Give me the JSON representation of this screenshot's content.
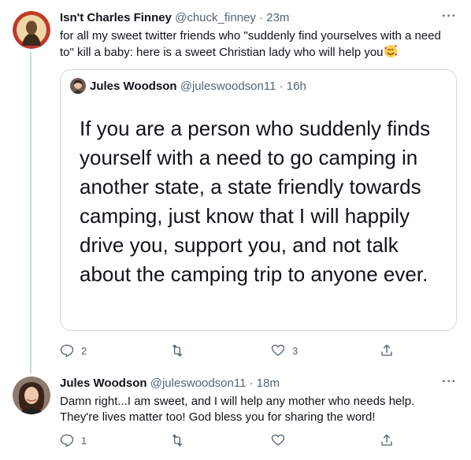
{
  "tweet1": {
    "display_name": "Isn't Charles Finney",
    "handle": "@chuck_finney",
    "separator": "·",
    "time": "23m",
    "text": "for all my sweet twitter friends who \"suddenly find yourselves with a need to\" kill a baby: here is a sweet Christian lady who will help you",
    "emoji": "smiling-face-with-hearts",
    "more_label": "···",
    "quote": {
      "display_name": "Jules Woodson",
      "handle": "@juleswoodson11",
      "separator": "·",
      "time": "16h",
      "text": "If you are a person who suddenly finds yourself with a need to go camping in another state, a state friendly towards camping, just know that I will happily drive you, support you, and not talk about the camping trip to anyone ever."
    },
    "actions": {
      "reply_count": "2",
      "retweet_count": "",
      "like_count": "3"
    }
  },
  "tweet2": {
    "display_name": "Jules Woodson",
    "handle": "@juleswoodson11",
    "separator": "·",
    "time": "18m",
    "text": "Damn right...I am sweet, and I will help any mother who needs help. They're lives matter too! God bless you for sharing the word!",
    "more_label": "···",
    "actions": {
      "reply_count": "1",
      "retweet_count": "",
      "like_count": ""
    }
  },
  "colors": {
    "text": "#0f1419",
    "muted": "#536471",
    "border": "#cfd9de"
  }
}
